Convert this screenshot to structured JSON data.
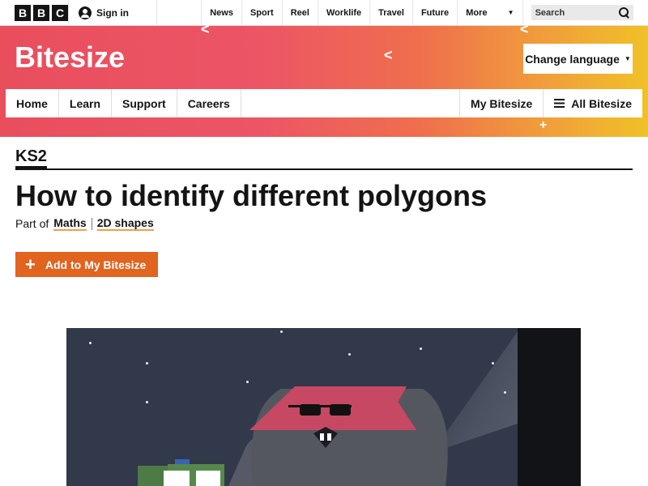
{
  "bbc_bar": {
    "logo_letters": [
      "B",
      "B",
      "C"
    ],
    "sign_in": "Sign in",
    "nav": [
      "News",
      "Sport",
      "Reel",
      "Worklife",
      "Travel",
      "Future"
    ],
    "more": "More",
    "search_placeholder": "Search"
  },
  "header": {
    "brand": "Bitesize",
    "change_language": "Change language",
    "subnav": [
      "Home",
      "Learn",
      "Support",
      "Careers"
    ],
    "my_bitesize": "My Bitesize",
    "all_bitesize": "All Bitesize",
    "gradient_colors": [
      "#e94e5d",
      "#ef6f4c",
      "#f0c128"
    ]
  },
  "article": {
    "key_stage": "KS2",
    "title": "How to identify different polygons",
    "part_of": "Part of",
    "breadcrumbs": [
      "Maths",
      "2D shapes"
    ],
    "add_button": "Add to My Bitesize",
    "accent_color": "#e1641f"
  }
}
